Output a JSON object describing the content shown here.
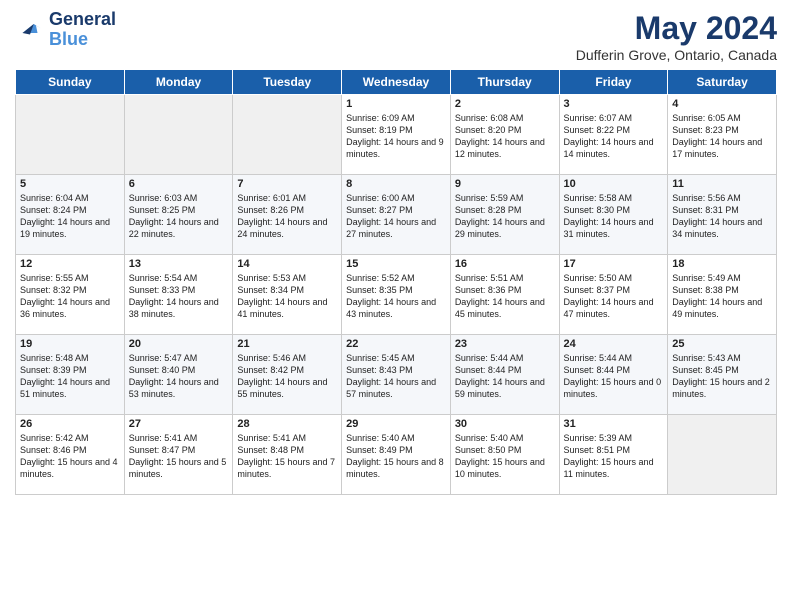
{
  "header": {
    "logo_line1": "General",
    "logo_line2": "Blue",
    "title": "May 2024",
    "subtitle": "Dufferin Grove, Ontario, Canada"
  },
  "days_of_week": [
    "Sunday",
    "Monday",
    "Tuesday",
    "Wednesday",
    "Thursday",
    "Friday",
    "Saturday"
  ],
  "weeks": [
    [
      {
        "day": "",
        "empty": true
      },
      {
        "day": "",
        "empty": true
      },
      {
        "day": "",
        "empty": true
      },
      {
        "day": "1",
        "sunrise": "Sunrise: 6:09 AM",
        "sunset": "Sunset: 8:19 PM",
        "daylight": "Daylight: 14 hours and 9 minutes."
      },
      {
        "day": "2",
        "sunrise": "Sunrise: 6:08 AM",
        "sunset": "Sunset: 8:20 PM",
        "daylight": "Daylight: 14 hours and 12 minutes."
      },
      {
        "day": "3",
        "sunrise": "Sunrise: 6:07 AM",
        "sunset": "Sunset: 8:22 PM",
        "daylight": "Daylight: 14 hours and 14 minutes."
      },
      {
        "day": "4",
        "sunrise": "Sunrise: 6:05 AM",
        "sunset": "Sunset: 8:23 PM",
        "daylight": "Daylight: 14 hours and 17 minutes."
      }
    ],
    [
      {
        "day": "5",
        "sunrise": "Sunrise: 6:04 AM",
        "sunset": "Sunset: 8:24 PM",
        "daylight": "Daylight: 14 hours and 19 minutes."
      },
      {
        "day": "6",
        "sunrise": "Sunrise: 6:03 AM",
        "sunset": "Sunset: 8:25 PM",
        "daylight": "Daylight: 14 hours and 22 minutes."
      },
      {
        "day": "7",
        "sunrise": "Sunrise: 6:01 AM",
        "sunset": "Sunset: 8:26 PM",
        "daylight": "Daylight: 14 hours and 24 minutes."
      },
      {
        "day": "8",
        "sunrise": "Sunrise: 6:00 AM",
        "sunset": "Sunset: 8:27 PM",
        "daylight": "Daylight: 14 hours and 27 minutes."
      },
      {
        "day": "9",
        "sunrise": "Sunrise: 5:59 AM",
        "sunset": "Sunset: 8:28 PM",
        "daylight": "Daylight: 14 hours and 29 minutes."
      },
      {
        "day": "10",
        "sunrise": "Sunrise: 5:58 AM",
        "sunset": "Sunset: 8:30 PM",
        "daylight": "Daylight: 14 hours and 31 minutes."
      },
      {
        "day": "11",
        "sunrise": "Sunrise: 5:56 AM",
        "sunset": "Sunset: 8:31 PM",
        "daylight": "Daylight: 14 hours and 34 minutes."
      }
    ],
    [
      {
        "day": "12",
        "sunrise": "Sunrise: 5:55 AM",
        "sunset": "Sunset: 8:32 PM",
        "daylight": "Daylight: 14 hours and 36 minutes."
      },
      {
        "day": "13",
        "sunrise": "Sunrise: 5:54 AM",
        "sunset": "Sunset: 8:33 PM",
        "daylight": "Daylight: 14 hours and 38 minutes."
      },
      {
        "day": "14",
        "sunrise": "Sunrise: 5:53 AM",
        "sunset": "Sunset: 8:34 PM",
        "daylight": "Daylight: 14 hours and 41 minutes."
      },
      {
        "day": "15",
        "sunrise": "Sunrise: 5:52 AM",
        "sunset": "Sunset: 8:35 PM",
        "daylight": "Daylight: 14 hours and 43 minutes."
      },
      {
        "day": "16",
        "sunrise": "Sunrise: 5:51 AM",
        "sunset": "Sunset: 8:36 PM",
        "daylight": "Daylight: 14 hours and 45 minutes."
      },
      {
        "day": "17",
        "sunrise": "Sunrise: 5:50 AM",
        "sunset": "Sunset: 8:37 PM",
        "daylight": "Daylight: 14 hours and 47 minutes."
      },
      {
        "day": "18",
        "sunrise": "Sunrise: 5:49 AM",
        "sunset": "Sunset: 8:38 PM",
        "daylight": "Daylight: 14 hours and 49 minutes."
      }
    ],
    [
      {
        "day": "19",
        "sunrise": "Sunrise: 5:48 AM",
        "sunset": "Sunset: 8:39 PM",
        "daylight": "Daylight: 14 hours and 51 minutes."
      },
      {
        "day": "20",
        "sunrise": "Sunrise: 5:47 AM",
        "sunset": "Sunset: 8:40 PM",
        "daylight": "Daylight: 14 hours and 53 minutes."
      },
      {
        "day": "21",
        "sunrise": "Sunrise: 5:46 AM",
        "sunset": "Sunset: 8:42 PM",
        "daylight": "Daylight: 14 hours and 55 minutes."
      },
      {
        "day": "22",
        "sunrise": "Sunrise: 5:45 AM",
        "sunset": "Sunset: 8:43 PM",
        "daylight": "Daylight: 14 hours and 57 minutes."
      },
      {
        "day": "23",
        "sunrise": "Sunrise: 5:44 AM",
        "sunset": "Sunset: 8:44 PM",
        "daylight": "Daylight: 14 hours and 59 minutes."
      },
      {
        "day": "24",
        "sunrise": "Sunrise: 5:44 AM",
        "sunset": "Sunset: 8:44 PM",
        "daylight": "Daylight: 15 hours and 0 minutes."
      },
      {
        "day": "25",
        "sunrise": "Sunrise: 5:43 AM",
        "sunset": "Sunset: 8:45 PM",
        "daylight": "Daylight: 15 hours and 2 minutes."
      }
    ],
    [
      {
        "day": "26",
        "sunrise": "Sunrise: 5:42 AM",
        "sunset": "Sunset: 8:46 PM",
        "daylight": "Daylight: 15 hours and 4 minutes."
      },
      {
        "day": "27",
        "sunrise": "Sunrise: 5:41 AM",
        "sunset": "Sunset: 8:47 PM",
        "daylight": "Daylight: 15 hours and 5 minutes."
      },
      {
        "day": "28",
        "sunrise": "Sunrise: 5:41 AM",
        "sunset": "Sunset: 8:48 PM",
        "daylight": "Daylight: 15 hours and 7 minutes."
      },
      {
        "day": "29",
        "sunrise": "Sunrise: 5:40 AM",
        "sunset": "Sunset: 8:49 PM",
        "daylight": "Daylight: 15 hours and 8 minutes."
      },
      {
        "day": "30",
        "sunrise": "Sunrise: 5:40 AM",
        "sunset": "Sunset: 8:50 PM",
        "daylight": "Daylight: 15 hours and 10 minutes."
      },
      {
        "day": "31",
        "sunrise": "Sunrise: 5:39 AM",
        "sunset": "Sunset: 8:51 PM",
        "daylight": "Daylight: 15 hours and 11 minutes."
      },
      {
        "day": "",
        "empty": true
      }
    ]
  ]
}
